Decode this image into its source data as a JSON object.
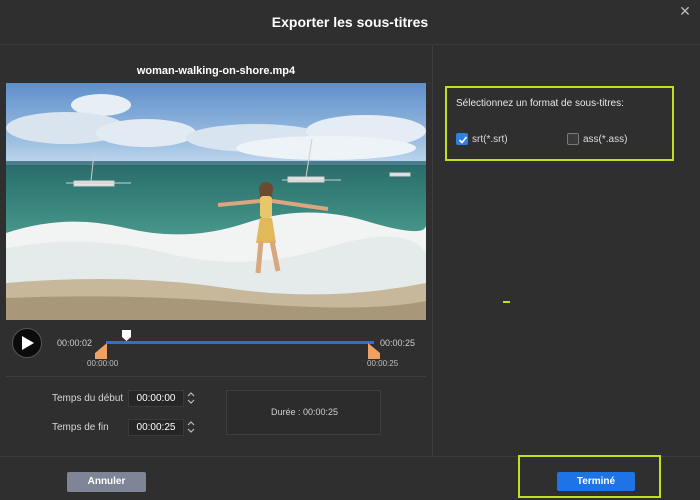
{
  "dialog": {
    "title": "Exporter les sous-titres",
    "close_icon": "close-icon"
  },
  "preview": {
    "filename": "woman-walking-on-shore.mp4",
    "current_time": "00:00:02",
    "total_time": "00:00:25",
    "range_start": "00:00:00",
    "range_end": "00:00:25",
    "playhead_position": 0.08
  },
  "trim": {
    "start_label": "Temps du début",
    "start_value": "00:00:00",
    "end_label": "Temps de fin",
    "end_value": "00:00:25",
    "duration_text": "Durée : 00:00:25"
  },
  "format": {
    "label": "Sélectionnez un format de sous-titres:",
    "options": [
      {
        "label": "srt(*.srt)",
        "checked": true
      },
      {
        "label": "ass(*.ass)",
        "checked": false
      }
    ]
  },
  "footer": {
    "cancel_label": "Annuler",
    "done_label": "Terminé"
  },
  "colors": {
    "accent": "#1e74e6",
    "highlight": "#c4e01b",
    "handle": "#f0a060"
  }
}
